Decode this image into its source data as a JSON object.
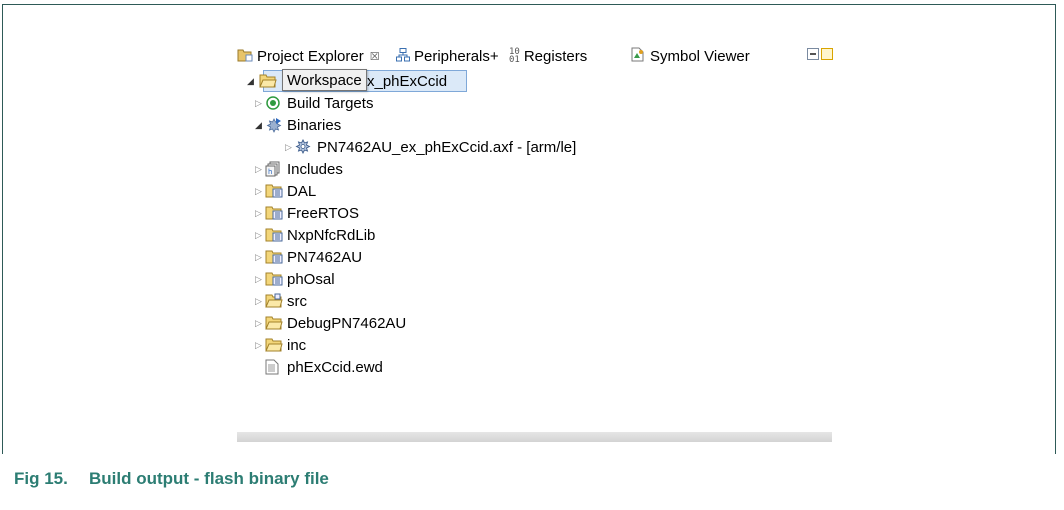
{
  "caption": {
    "number": "Fig 15.",
    "title": "Build output - flash binary file"
  },
  "tabs": [
    {
      "label": "Project Explorer",
      "icon": "project-explorer-icon",
      "active": true,
      "close": "☒"
    },
    {
      "label": "Peripherals+",
      "icon": "peripherals-icon"
    },
    {
      "label": "Registers",
      "icon": "registers-icon"
    },
    {
      "label": "Symbol Viewer",
      "icon": "symbol-viewer-icon"
    }
  ],
  "tooltip": "Workspace",
  "tree": {
    "project": "x_phExCcid",
    "items": [
      {
        "label": "Build Targets",
        "icon": "build-targets-icon"
      },
      {
        "label": "Binaries",
        "icon": "binaries-icon",
        "expanded": true
      },
      {
        "label": "PN7462AU_ex_phExCcid.axf - [arm/le]",
        "icon": "axf-binary-icon"
      },
      {
        "label": "Includes",
        "icon": "includes-icon"
      },
      {
        "label": "DAL",
        "icon": "source-folder-icon"
      },
      {
        "label": "FreeRTOS",
        "icon": "source-folder-icon"
      },
      {
        "label": "NxpNfcRdLib",
        "icon": "source-folder-icon"
      },
      {
        "label": "PN7462AU",
        "icon": "source-folder-icon"
      },
      {
        "label": "phOsal",
        "icon": "source-folder-icon"
      },
      {
        "label": "src",
        "icon": "source-folder-icon"
      },
      {
        "label": "DebugPN7462AU",
        "icon": "folder-icon"
      },
      {
        "label": "inc",
        "icon": "folder-icon"
      },
      {
        "label": "phExCcid.ewd",
        "icon": "file-icon"
      }
    ]
  },
  "colors": {
    "caption": "#2c7d73",
    "frame": "#2e5a57",
    "selection": "#dbe9f8"
  }
}
